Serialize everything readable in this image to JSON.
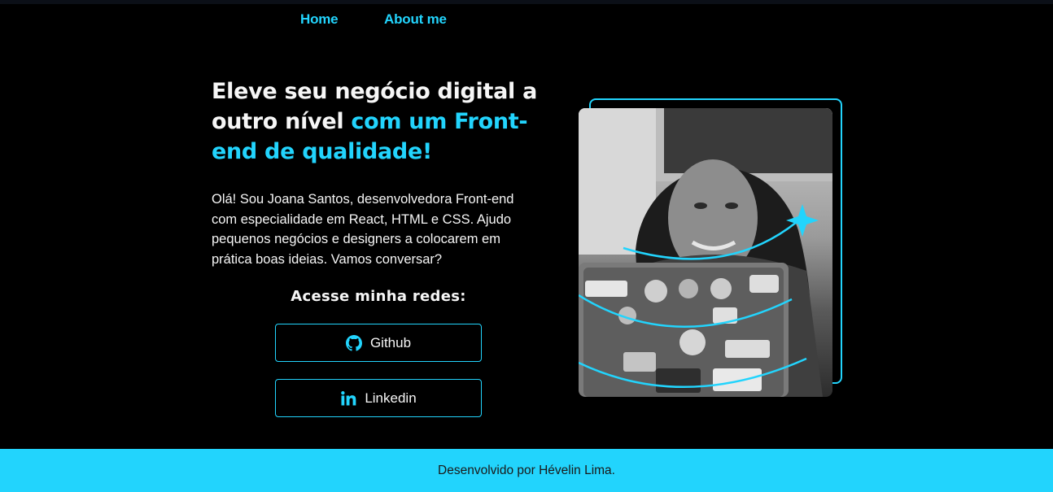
{
  "nav": {
    "home_label": "Home",
    "about_label": "About me"
  },
  "hero": {
    "headline_part1": "Eleve seu negócio digital a outro nível ",
    "headline_accent": "com um Front-end de qualidade!",
    "intro": "Olá! Sou Joana Santos, desenvolvedora Front-end com especialidade em React, HTML e CSS. Ajudo pequenos negócios e designers a colocarem em prática boas ideias. Vamos conversar?",
    "social_title": "Acesse minha redes:",
    "github_label": "Github",
    "linkedin_label": "Linkedin",
    "github_icon": "github-icon",
    "linkedin_icon": "linkedin-icon"
  },
  "footer": {
    "text": "Desenvolvido por Hévelin Lima."
  },
  "colors": {
    "background": "#000000",
    "accent": "#22d4fd",
    "text": "#f6f6f6",
    "footer_text": "#1a1a1a"
  }
}
